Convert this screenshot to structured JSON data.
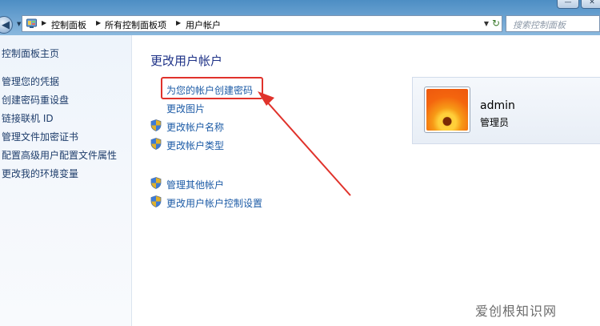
{
  "addressbar": {
    "breadcrumbs": [
      "控制面板",
      "所有控制面板项",
      "用户帐户"
    ]
  },
  "search": {
    "placeholder": "搜索控制面板"
  },
  "window_controls": {
    "minimize": "—",
    "close": "✕"
  },
  "leftpane": {
    "home": "控制面板主页",
    "links": [
      "管理您的凭据",
      "创建密码重设盘",
      "链接联机 ID",
      "管理文件加密证书",
      "配置高级用户配置文件属性",
      "更改我的环境变量"
    ]
  },
  "main": {
    "heading": "更改用户帐户",
    "tasks": [
      {
        "label": "为您的帐户创建密码",
        "icon": "none",
        "highlighted": true
      },
      {
        "label": "更改图片",
        "icon": "none"
      },
      {
        "label": "更改帐户名称",
        "icon": "uac-shield-icon"
      },
      {
        "label": "更改帐户类型",
        "icon": "uac-shield-icon"
      }
    ],
    "other_tasks": [
      {
        "label": "管理其他帐户",
        "icon": "uac-shield-icon"
      },
      {
        "label": "更改用户帐户控制设置",
        "icon": "uac-shield-icon"
      }
    ]
  },
  "user": {
    "name": "admin",
    "role": "管理员"
  },
  "watermark": "爱创根知识网",
  "colors": {
    "link": "#1c5ba6",
    "heading": "#1e3287",
    "highlight": "#e0322b",
    "titlebar": "#4d8ec4"
  }
}
